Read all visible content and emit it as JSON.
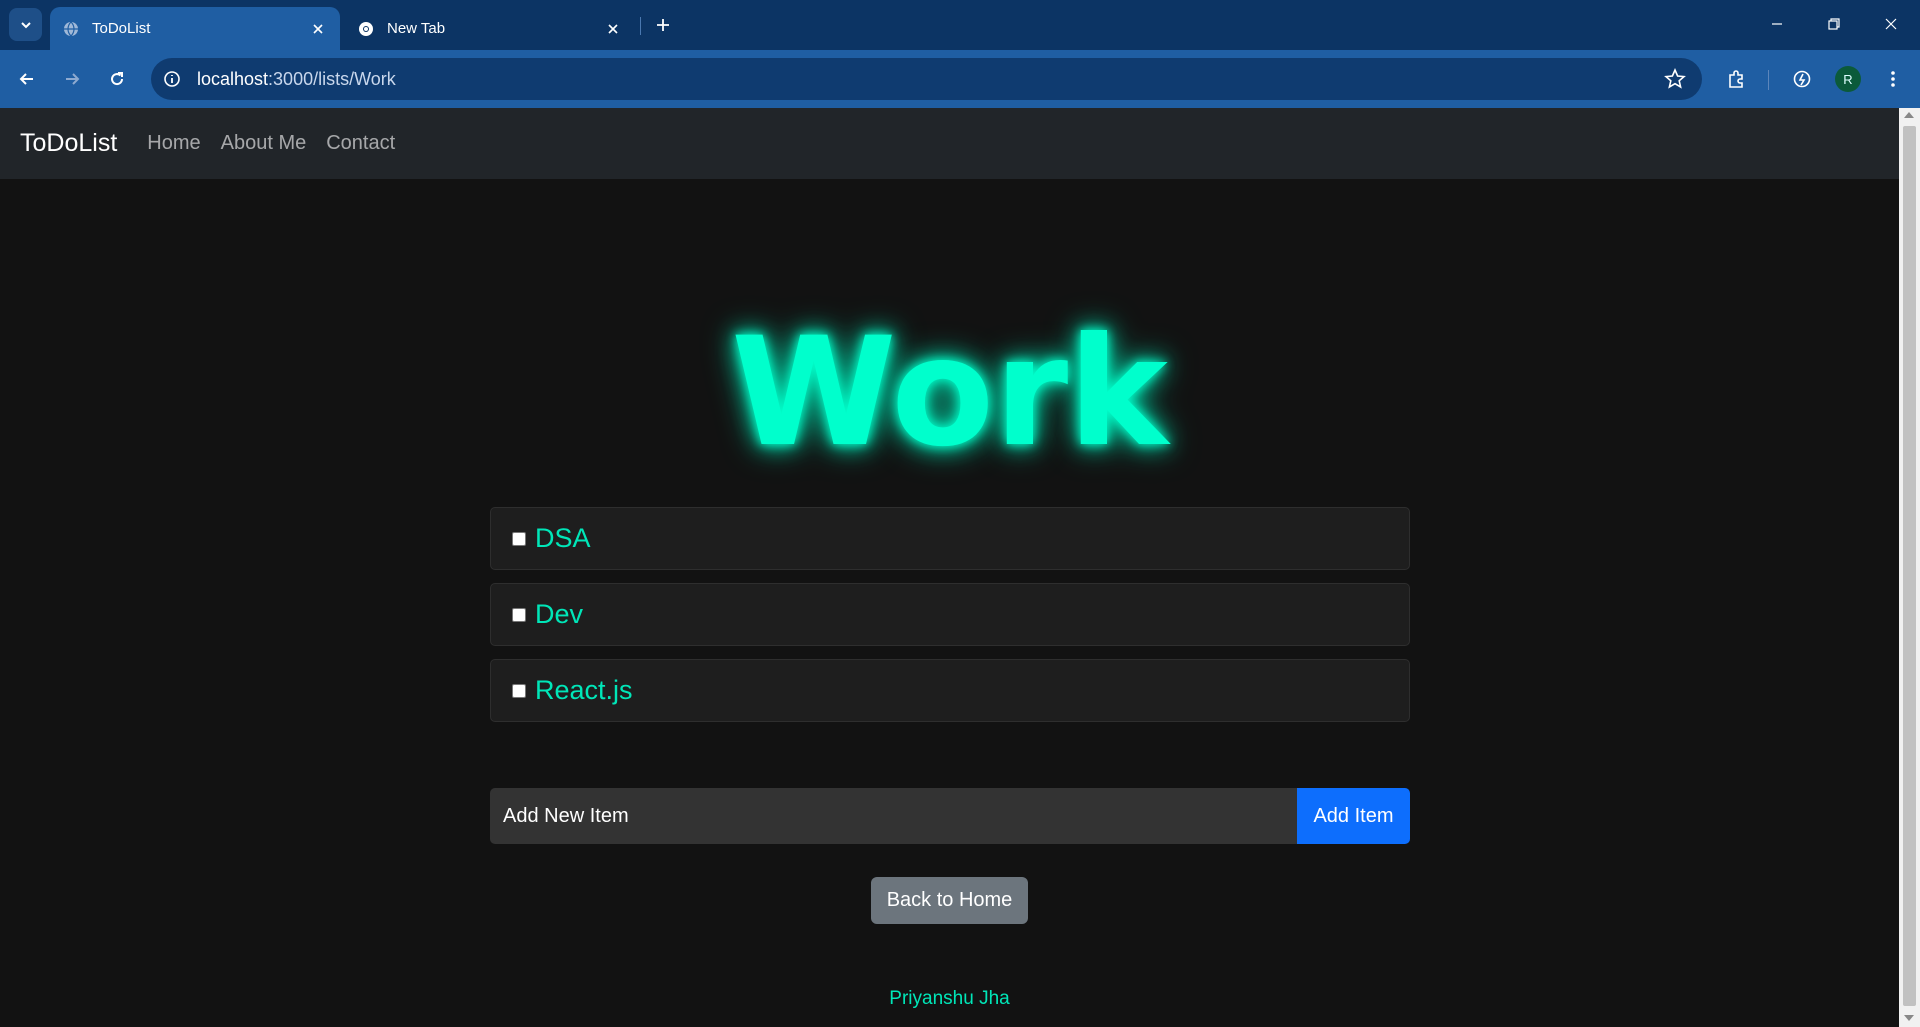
{
  "browser": {
    "tabs": [
      {
        "title": "ToDoList",
        "active": true,
        "icon": "globe-icon"
      },
      {
        "title": "New Tab",
        "active": false,
        "icon": "chrome-icon"
      }
    ],
    "url": {
      "host": "localhost",
      "path": ":3000/lists/Work"
    },
    "profile_initial": "R"
  },
  "navbar": {
    "brand": "ToDoList",
    "links": [
      "Home",
      "About Me",
      "Contact"
    ]
  },
  "list": {
    "title": "Work",
    "items": [
      "DSA",
      "Dev",
      "React.js"
    ]
  },
  "form": {
    "placeholder": "Add New Item",
    "button_label": "Add Item"
  },
  "back_button": "Back to Home",
  "footer": "Priyanshu Jha",
  "colors": {
    "accent": "#00ffcc",
    "primary": "#0d6efd",
    "secondary": "#6c757d",
    "navbar": "#212529",
    "background": "#121212"
  }
}
